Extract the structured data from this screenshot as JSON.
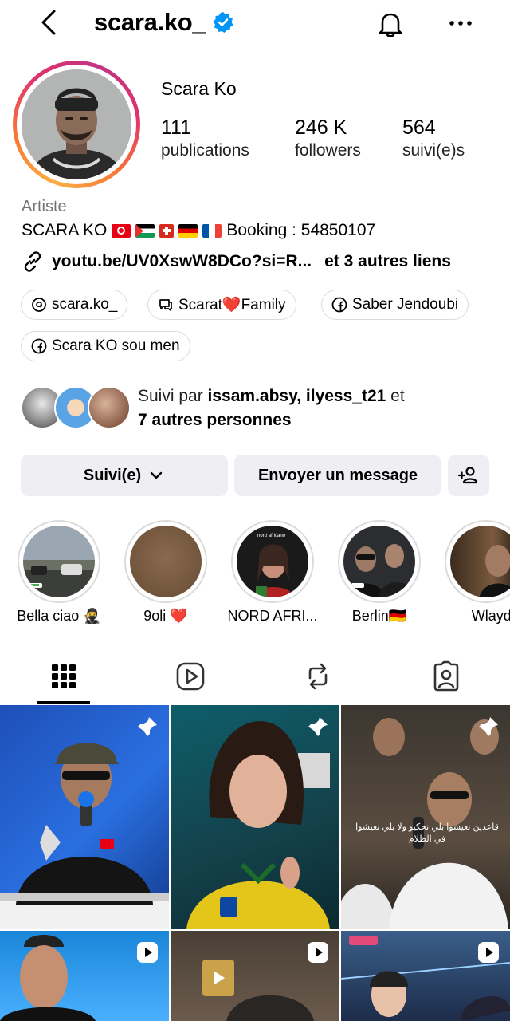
{
  "header": {
    "username": "scara.ko_",
    "icons": {
      "back": "chevron-left-icon",
      "verified": "verified-badge-icon",
      "notifications": "bell-icon",
      "more": "more-horizontal-icon"
    }
  },
  "profile": {
    "display_name": "Scara Ko",
    "stats": [
      {
        "value": "111",
        "label": "publications"
      },
      {
        "value": "246 K",
        "label": "followers"
      },
      {
        "value": "564",
        "label": "suivi(e)s"
      }
    ],
    "category": "Artiste",
    "bio_prefix": "SCARA KO",
    "bio_flags": [
      "Tunisia",
      "Palestine",
      "Switzerland",
      "Germany",
      "France"
    ],
    "bio_suffix": "Booking : 54850107",
    "link_text": "youtu.be/UV0XswW8DCo?si=R...",
    "link_more": "et 3 autres liens",
    "pills": [
      {
        "icon": "threads-icon",
        "label": "scara.ko_"
      },
      {
        "icon": "community-chat-icon",
        "label": "Scarat❤️Family"
      },
      {
        "icon": "facebook-icon",
        "label": "Saber Jendoubi"
      },
      {
        "icon": "facebook-icon",
        "label": "Scara KO sou men"
      }
    ],
    "mutual": {
      "prefix": "Suivi par ",
      "names": "issam.absy, ilyess_t21",
      "joiner": " et",
      "others": "7 autres personnes"
    }
  },
  "actions": {
    "follow_label": "Suivi(e)",
    "message_label": "Envoyer un message",
    "suggest_icon": "add-person-icon"
  },
  "highlights": [
    {
      "label": "Bella ciao 🥷"
    },
    {
      "label": "9oli ❤️"
    },
    {
      "label": "NORD AFRI..."
    },
    {
      "label": "Berlin🇩🇪"
    },
    {
      "label": "Wlaydi🖤"
    }
  ],
  "highlight_overlay_text": "nord africano",
  "tabs": [
    {
      "icon": "grid-icon",
      "active": true
    },
    {
      "icon": "reels-icon",
      "active": false
    },
    {
      "icon": "reposts-icon",
      "active": false
    },
    {
      "icon": "tagged-icon",
      "active": false
    }
  ],
  "posts": [
    {
      "type": "pinned"
    },
    {
      "type": "pinned"
    },
    {
      "type": "pinned",
      "caption": "قاعدين نعيشوا بلي نحكيو ولا بلي نعيشوا في الظلام"
    },
    {
      "type": "reel"
    },
    {
      "type": "reel"
    },
    {
      "type": "reel"
    }
  ],
  "colors": {
    "verified_blue": "#0095f6",
    "button_bg": "#efeff3",
    "muted_text": "#737373",
    "ring_gradient": [
      "#fcaf45",
      "#f77737",
      "#e1306c",
      "#c13584"
    ]
  }
}
